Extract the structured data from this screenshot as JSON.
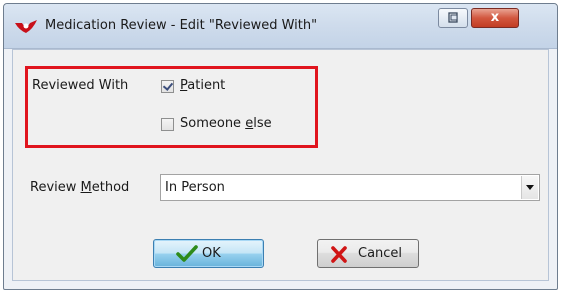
{
  "window": {
    "title": "Medication Review - Edit \"Reviewed With\"",
    "close_label": "x"
  },
  "reviewed_with": {
    "label": "Reviewed With",
    "patient": {
      "pre": "",
      "acc": "P",
      "post": "atient",
      "checked": true
    },
    "someone_else": {
      "pre": "Someone ",
      "acc": "e",
      "post": "lse",
      "checked": false
    }
  },
  "review_method": {
    "label_pre": "Review ",
    "label_acc": "M",
    "label_post": "ethod",
    "value": "In Person"
  },
  "buttons": {
    "ok": "OK",
    "cancel": "Cancel"
  },
  "colors": {
    "highlight_box": "#e0141e",
    "ok_check": "#2e8b1a",
    "cancel_x": "#d01515"
  }
}
